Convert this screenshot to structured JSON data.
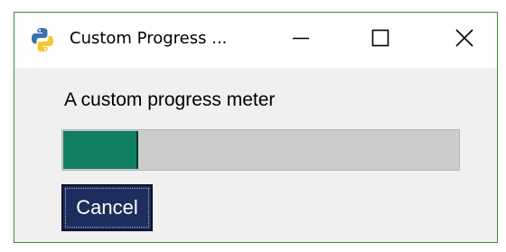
{
  "window": {
    "title": "Custom Progress ...",
    "app_icon": "python-icon",
    "controls": {
      "minimize_icon": "minimize-icon",
      "maximize_icon": "maximize-icon",
      "close_icon": "close-icon"
    }
  },
  "dialog": {
    "message": "A custom progress meter",
    "progress_fraction": 0.19,
    "progress_color": "#0f7f64",
    "track_color": "#cccccc",
    "cancel_label": "Cancel",
    "cancel_bg": "#1c2e5c"
  }
}
